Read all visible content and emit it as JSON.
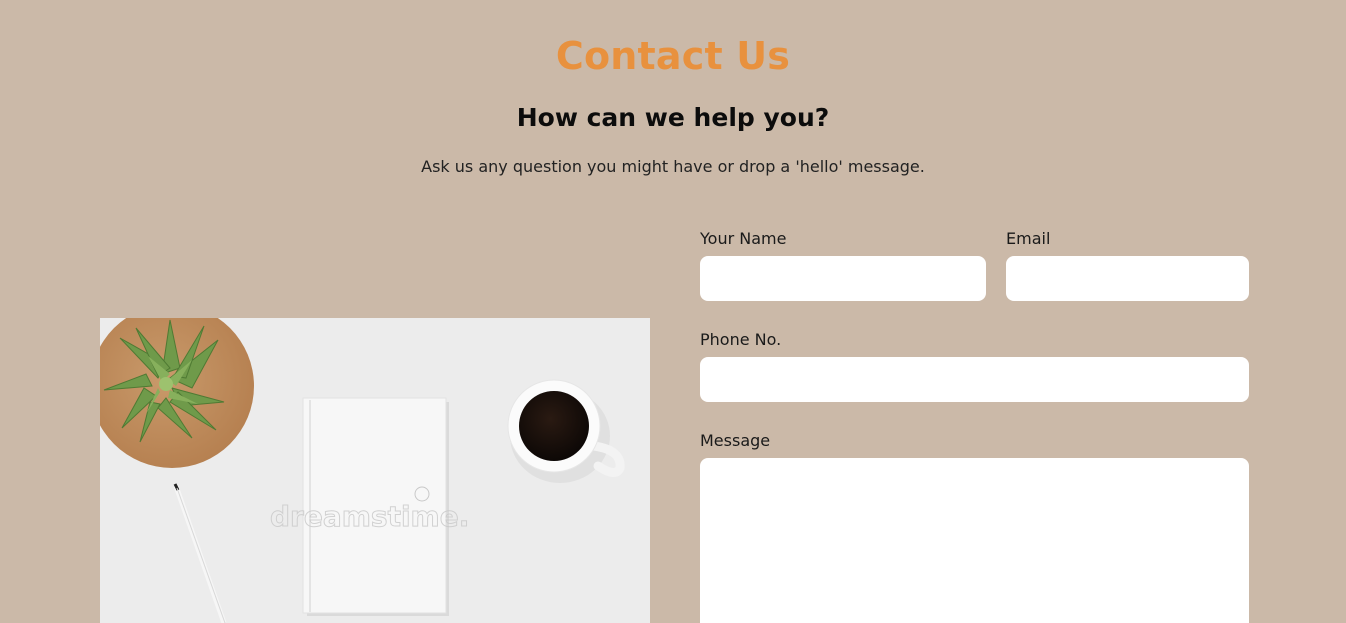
{
  "header": {
    "title": "Contact Us",
    "subtitle": "How can we help you?",
    "lead": "Ask us any question you might have or drop a 'hello' message."
  },
  "image": {
    "watermark": "dreamstime."
  },
  "form": {
    "name": {
      "label": "Your Name",
      "value": "",
      "placeholder": ""
    },
    "email": {
      "label": "Email",
      "value": "",
      "placeholder": ""
    },
    "phone": {
      "label": "Phone No.",
      "value": "",
      "placeholder": ""
    },
    "message": {
      "label": "Message",
      "value": "",
      "placeholder": ""
    }
  },
  "colors": {
    "background": "#cbb9a8",
    "accent": "#e8913e",
    "input_bg": "#ffffff"
  }
}
